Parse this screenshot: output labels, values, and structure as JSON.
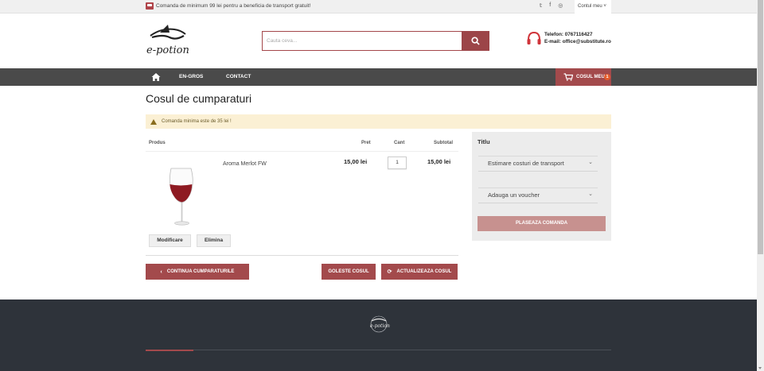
{
  "topbar": {
    "promo": "Comanda de minimum 99 lei pentru a beneficia de transport gratuit!",
    "social_icons": [
      "twitter-icon",
      "facebook-icon",
      "instagram-icon"
    ],
    "social_glyphs": [
      "𝕥",
      "f",
      "◎"
    ],
    "account_label": "Contul meu ˅"
  },
  "header": {
    "logo_text": "e-potion",
    "search_placeholder": "Cauta ceva...",
    "phone": "Telefon: 0767116427",
    "email": "E-mail: office@substitute.ro"
  },
  "nav": {
    "items": [
      "EN-GROS",
      "CONTACT"
    ],
    "cart_label": "COSUL MEU",
    "cart_count": "1"
  },
  "cart": {
    "title": "Cosul de cumparaturi",
    "notice": "Comanda minima este de 35 lei !",
    "headers": {
      "product": "Produs",
      "price": "Pret",
      "qty": "Cant",
      "subtotal": "Subtotal"
    },
    "item": {
      "name": "Aroma Merlot FW",
      "price": "15,00 lei",
      "qty": "1",
      "subtotal": "15,00 lei"
    },
    "edit_label": "Modificare",
    "remove_label": "Elimina",
    "continue_label": "CONTINUA CUMPARATURILE",
    "empty_label": "GOLESTE COSUL",
    "update_label": "ACTUALIZEAZA COSUL"
  },
  "sidebar": {
    "title": "Titlu",
    "shipping_label": "Estimare costuri de transport",
    "voucher_label": "Adauga un voucher",
    "place_order_label": "PLASEAZA COMANDA"
  },
  "footer": {
    "logo_text": "e-potion"
  },
  "colors": {
    "brand": "#a34a4c",
    "nav_bg": "#4a4a4a",
    "footer_bg": "#2e333a",
    "notice_bg": "#fbf0d4"
  }
}
